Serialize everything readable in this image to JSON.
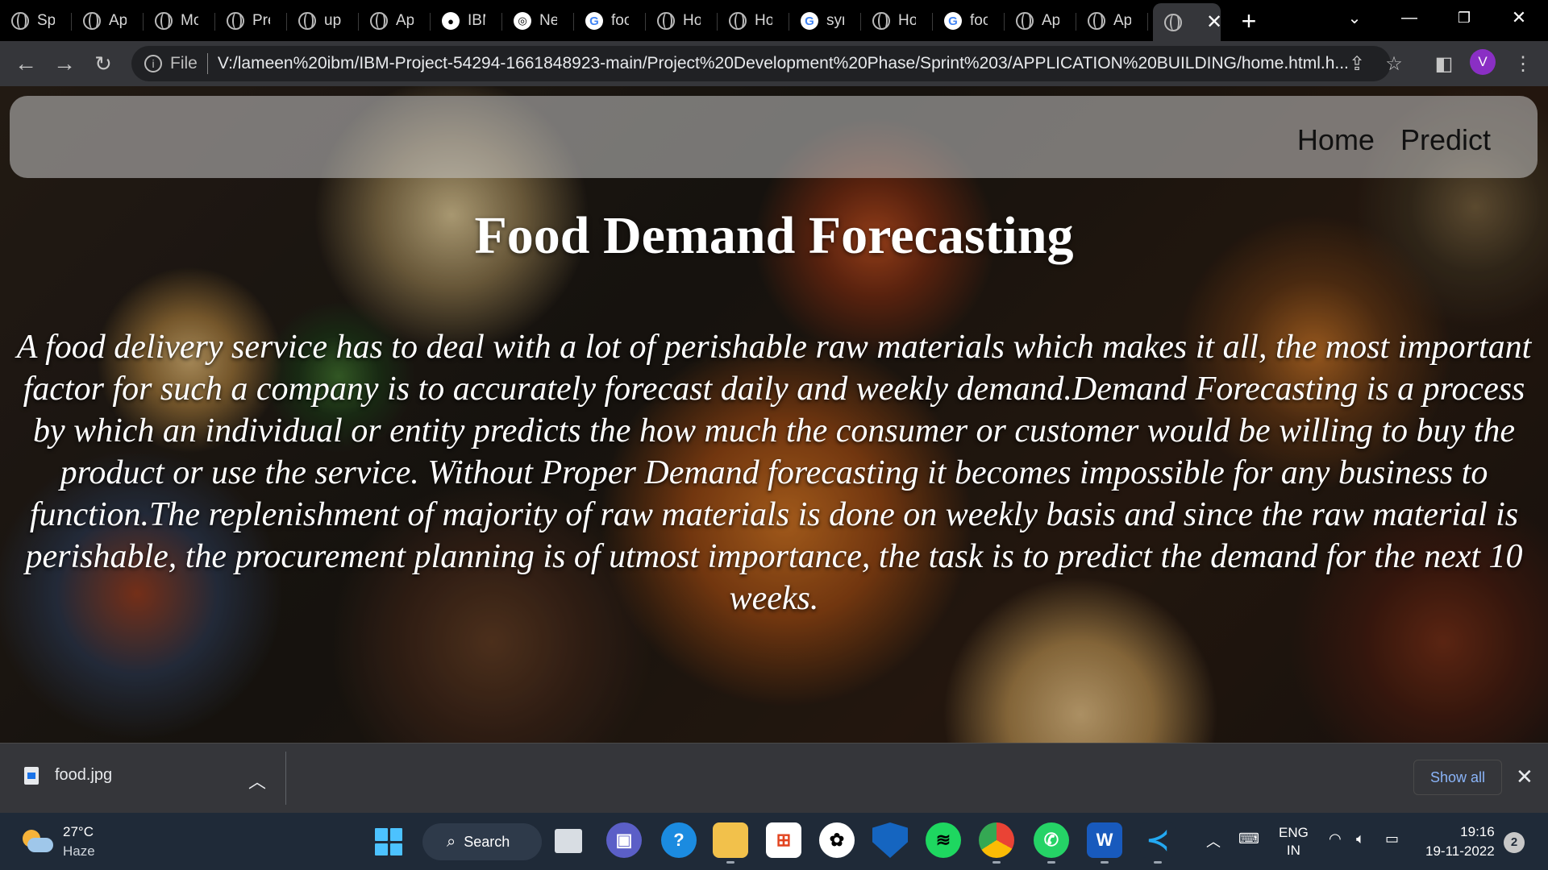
{
  "browser": {
    "tabs": [
      {
        "title": "Sprint",
        "favicon": "globe-icon"
      },
      {
        "title": "App",
        "favicon": "globe-icon"
      },
      {
        "title": "Mo",
        "favicon": "globe-icon"
      },
      {
        "title": "Pre",
        "favicon": "globe-icon"
      },
      {
        "title": "upl",
        "favicon": "globe-icon"
      },
      {
        "title": "App",
        "favicon": "globe-icon"
      },
      {
        "title": "IBM",
        "favicon": "github-icon"
      },
      {
        "title": "New",
        "favicon": "chromium-icon"
      },
      {
        "title": "foo",
        "favicon": "google-icon"
      },
      {
        "title": "Hor",
        "favicon": "globe-icon"
      },
      {
        "title": "Hor",
        "favicon": "globe-icon"
      },
      {
        "title": "syn",
        "favicon": "google-icon"
      },
      {
        "title": "Hor",
        "favicon": "globe-icon"
      },
      {
        "title": "foo",
        "favicon": "google-icon"
      },
      {
        "title": "App",
        "favicon": "globe-icon"
      },
      {
        "title": "App",
        "favicon": "globe-icon"
      }
    ],
    "active_tab_close": "✕",
    "new_tab": "+",
    "address": {
      "scheme_label": "File",
      "url": "V:/lameen%20ibm/IBM-Project-54294-1661848923-main/Project%20Development%20Phase/Sprint%203/APPLICATION%20BUILDING/home.html.h..."
    },
    "profile_initial": "V"
  },
  "page": {
    "nav": {
      "home": "Home",
      "predict": "Predict"
    },
    "title": "Food Demand Forecasting",
    "description": "A food delivery service has to deal with a lot of perishable raw materials which makes it all, the most important factor for such a company is to accurately forecast daily and weekly demand.Demand Forecasting is a process by which an individual or entity predicts the how much the consumer or customer would be willing to buy the product or use the service. Without Proper Demand forecasting it becomes impossible for any business to function.The replenishment of majority of raw materials is done on weekly basis and since the raw material is perishable, the procurement planning is of utmost importance, the task is to predict the demand for the next 10 weeks."
  },
  "downloads": {
    "file_name": "food.jpg",
    "show_all": "Show all"
  },
  "taskbar": {
    "weather": {
      "temp": "27°C",
      "desc": "Haze"
    },
    "search_label": "Search",
    "language": {
      "line1": "ENG",
      "line2": "IN"
    },
    "clock": {
      "time": "19:16",
      "date": "19-11-2022"
    },
    "notifications": "2"
  }
}
